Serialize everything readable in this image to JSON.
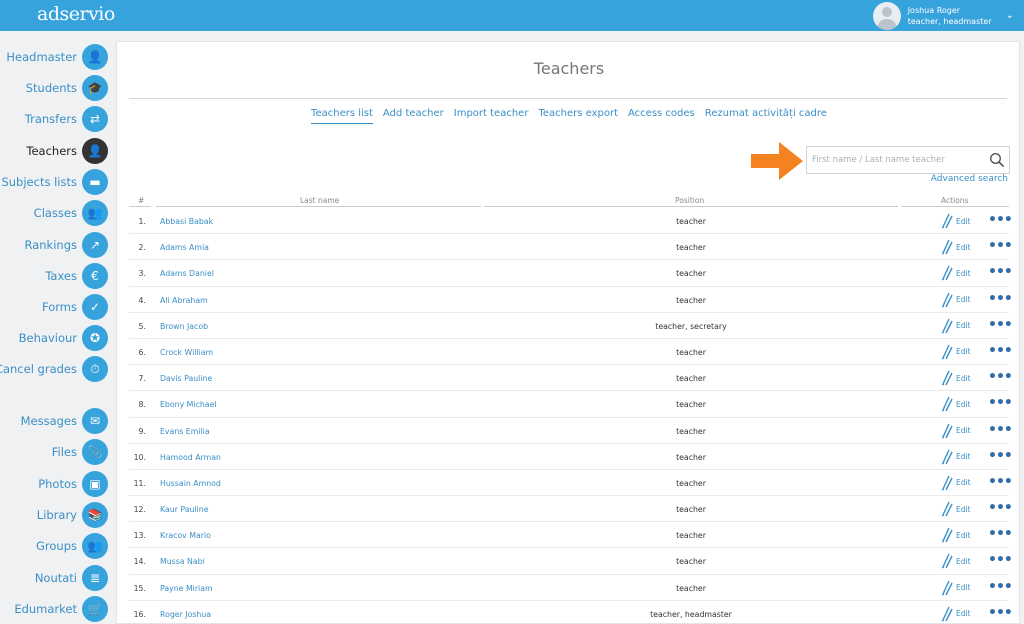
{
  "app": {
    "logo": "adservio"
  },
  "user": {
    "name": "Joshua Roger",
    "role": "teacher, headmaster"
  },
  "sidebar": {
    "items": [
      {
        "label": "Headmaster",
        "icon": "person-tie-icon",
        "glyph": "👤"
      },
      {
        "label": "Students",
        "icon": "graduate-icon",
        "glyph": "🎓"
      },
      {
        "label": "Transfers",
        "icon": "swap-arrows-icon",
        "glyph": "⇄"
      },
      {
        "label": "Teachers",
        "icon": "teacher-icon",
        "glyph": "👤"
      },
      {
        "label": "Subjects lists",
        "icon": "list-icon",
        "glyph": "▬"
      },
      {
        "label": "Classes",
        "icon": "classroom-icon",
        "glyph": "👥"
      },
      {
        "label": "Rankings",
        "icon": "chart-line-icon",
        "glyph": "↗"
      },
      {
        "label": "Taxes",
        "icon": "euro-icon",
        "glyph": "€"
      },
      {
        "label": "Forms",
        "icon": "form-check-icon",
        "glyph": "✓"
      },
      {
        "label": "Behaviour",
        "icon": "medal-icon",
        "glyph": "✪"
      },
      {
        "label": "Cancel grades",
        "icon": "timer-icon",
        "glyph": "⏱"
      },
      {
        "label": "Messages",
        "icon": "envelope-icon",
        "glyph": "✉"
      },
      {
        "label": "Files",
        "icon": "paperclip-icon",
        "glyph": "📎"
      },
      {
        "label": "Photos",
        "icon": "photos-icon",
        "glyph": "▣"
      },
      {
        "label": "Library",
        "icon": "books-icon",
        "glyph": "📚"
      },
      {
        "label": "Groups",
        "icon": "group-icon",
        "glyph": "👥"
      },
      {
        "label": "Noutati",
        "icon": "newspaper-icon",
        "glyph": "≣"
      },
      {
        "label": "Edumarket",
        "icon": "cart-icon",
        "glyph": "🛒"
      }
    ]
  },
  "main": {
    "title": "Teachers",
    "tabs": [
      {
        "label": "Teachers list"
      },
      {
        "label": "Add teacher"
      },
      {
        "label": "Import teacher"
      },
      {
        "label": "Teachers export"
      },
      {
        "label": "Access codes"
      },
      {
        "label": "Rezumat activități cadre"
      }
    ],
    "search": {
      "placeholder": "First name / Last name teacher",
      "value": ""
    },
    "advanced_search": "Advanced search",
    "table": {
      "headers": {
        "num": "#",
        "name": "Last name",
        "position": "Position",
        "actions": "Actions"
      },
      "edit_label": "Edit",
      "rows": [
        {
          "num": "1.",
          "name": "Abbasi Babak",
          "position": "teacher"
        },
        {
          "num": "2.",
          "name": "Adams Amia",
          "position": "teacher"
        },
        {
          "num": "3.",
          "name": "Adams Daniel",
          "position": "teacher"
        },
        {
          "num": "4.",
          "name": "Ali Abraham",
          "position": "teacher"
        },
        {
          "num": "5.",
          "name": "Brown Jacob",
          "position": "teacher, secretary"
        },
        {
          "num": "6.",
          "name": "Crock William",
          "position": "teacher"
        },
        {
          "num": "7.",
          "name": "Davis Pauline",
          "position": "teacher"
        },
        {
          "num": "8.",
          "name": "Ebony Michael",
          "position": "teacher"
        },
        {
          "num": "9.",
          "name": "Evans Emilia",
          "position": "teacher"
        },
        {
          "num": "10.",
          "name": "Hamood Arman",
          "position": "teacher"
        },
        {
          "num": "11.",
          "name": "Hussain Amnod",
          "position": "teacher"
        },
        {
          "num": "12.",
          "name": "Kaur Pauline",
          "position": "teacher"
        },
        {
          "num": "13.",
          "name": "Kracov Mario",
          "position": "teacher"
        },
        {
          "num": "14.",
          "name": "Mussa Nabi",
          "position": "teacher"
        },
        {
          "num": "15.",
          "name": "Payne Miriam",
          "position": "teacher"
        },
        {
          "num": "16.",
          "name": "Roger Joshua",
          "position": "teacher, headmaster"
        }
      ]
    }
  },
  "colors": {
    "brand": "#37a3dd",
    "link": "#3a8fc6",
    "arrow": "#f58220",
    "active_nav": "#333333"
  }
}
